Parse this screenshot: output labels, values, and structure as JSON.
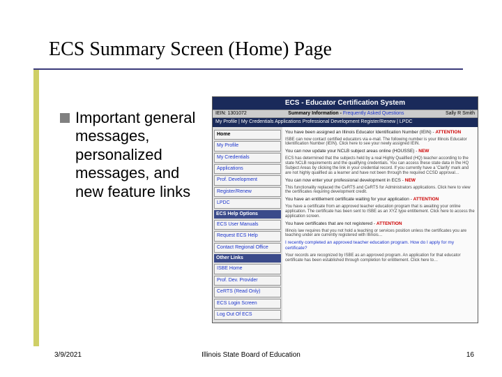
{
  "title": "ECS Summary Screen (Home) Page",
  "bullet": "Important general messages, personalized messages, and new feature links",
  "footer": {
    "date": "3/9/2021",
    "center": "Illinois State Board of Education",
    "page": "16"
  },
  "app": {
    "header": "ECS - Educator Certification System",
    "topbar": {
      "left": "IEIN:  1301072",
      "mid_bold": "Summary Information",
      "mid_link": "Frequently Asked Questions",
      "right": "Sally R Smith"
    },
    "nav": "My Profile  |  My Credentials       Applications       Professional Development       Register/Renew  |  LPDC",
    "side": {
      "home": "Home",
      "items1": [
        "My Profile",
        "My Credentials",
        "Applications",
        "Prof. Development",
        "Register/Renew",
        "LPDC"
      ],
      "hdr2": "ECS Help Options",
      "items2": [
        "ECS User Manuals",
        "Request ECS Help",
        "Contact Regional Office"
      ],
      "hdr3": "Other Links",
      "items3": [
        "ISBE Home",
        "Prof. Dev. Provider",
        "CeRTS (Read Only)",
        "ECS Login Screen",
        "Log Out Of ECS"
      ]
    },
    "main": {
      "p1a": "You have been assigned an Illinois Educator Identification Number (IEIN) - ",
      "p1b": "ATTENTION",
      "p1sub": "ISBE can now contact certified educators via e-mail. The following number is your Illinois Educator Identification Number (IEIN). Click here to see your newly assigned IEIN.",
      "p2a": "You can now update your NCLB subject areas online (HOUSSE) - ",
      "p2b": "NEW",
      "p2sub": "ECS has determined that the subjects held by a real Highly Qualified (HQ) teacher according to the state NCLB requirements and the qualifying credentials. You can access these state data in the HQ Subject Areas by clicking the link in your credential record. If you currently have a 'Clarify' mark and are not highly qualified as a learner and have not been through the required CCSD approval…",
      "p3a": "You can now enter your professional development in ECS - ",
      "p3b": "NEW",
      "p3sub": "This functionality replaced the CeRTS and CeRTS for Administrators applications. Click here to view the certificates requiring development credit.",
      "p4a": "You have an entitlement certificate waiting for your application - ",
      "p4b": "ATTENTION",
      "p4sub": "You have a certificate from an approved teacher education program that is awaiting your online application. The certificate has been sent to ISBE as an XYZ type entitlement. Click here to access the application screen.",
      "p5a": "You have certificates that are not registered - ",
      "p5b": "ATTENTION",
      "p5sub": "Illinois law requires that you not hold a teaching or services position unless the certificates you are teaching under are currently registered with Illinois…",
      "p6": "I recently completed an approved teacher education program. How do I apply for my certificate?",
      "p6sub": "Your records are recognized by ISBE as an approved program. An application for that educator certificate has been established through completion for entitlement. Click here to…"
    }
  }
}
